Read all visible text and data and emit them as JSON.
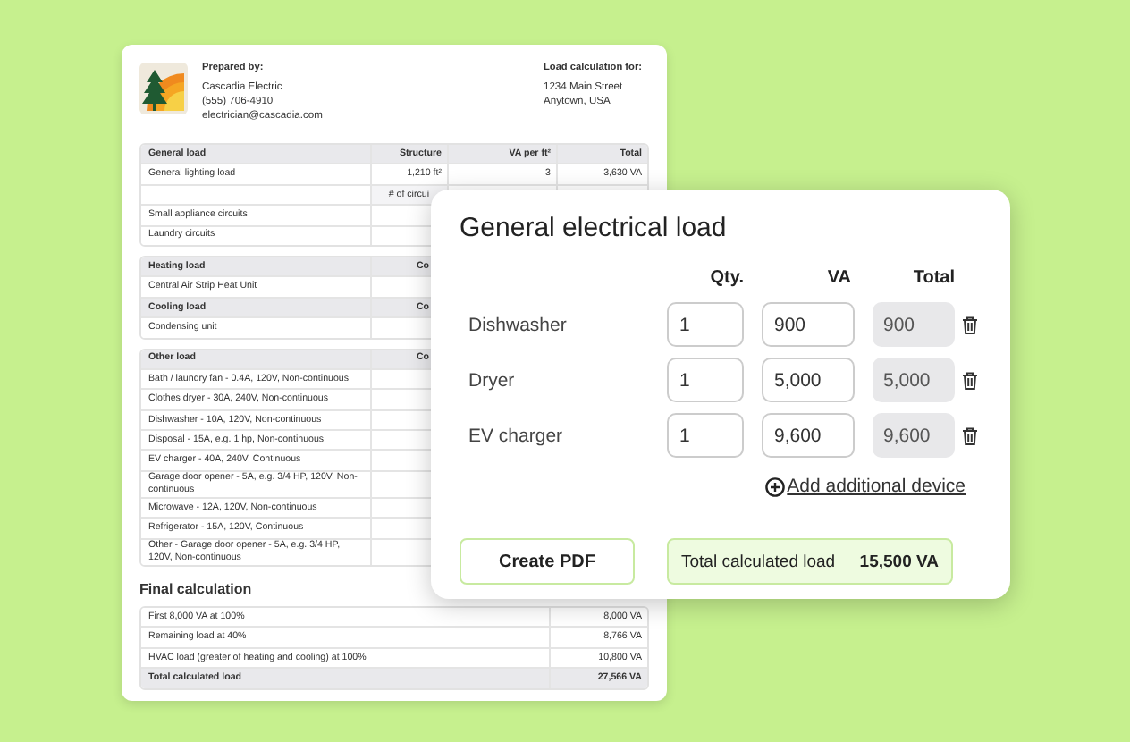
{
  "document": {
    "prepared_by": {
      "label": "Prepared by:",
      "lines": [
        "Cascadia Electric",
        "(555) 706-4910",
        "electrician@cascadia.com"
      ]
    },
    "load_for": {
      "label": "Load calculation for:",
      "lines": [
        "1234 Main Street",
        "Anytown, USA"
      ]
    },
    "tables": [
      {
        "kind": "full",
        "rows": [
          {
            "kind": "header",
            "label": "General load",
            "values": [
              "Structure",
              "VA per ft²",
              "Total"
            ]
          },
          {
            "kind": "row",
            "label": "General lighting load",
            "values": [
              "1,210 ft²",
              "3",
              "3,630 VA"
            ]
          },
          {
            "kind": "subheader",
            "values": [
              "# of circui"
            ]
          },
          {
            "kind": "row",
            "label": "Small appliance circuits"
          },
          {
            "kind": "row",
            "label": "Laundry circuits"
          }
        ]
      },
      {
        "kind": "partial",
        "rows": [
          {
            "kind": "header",
            "label": "Heating load",
            "values": [
              "Co"
            ]
          },
          {
            "kind": "row",
            "label": "Central Air Strip Heat Unit"
          },
          {
            "kind": "header",
            "label": "Cooling load",
            "values": [
              "Co"
            ]
          },
          {
            "kind": "row",
            "label": "Condensing unit"
          }
        ]
      },
      {
        "kind": "partial",
        "rows": [
          {
            "kind": "header",
            "label": "Other load",
            "values": [
              "Co"
            ]
          },
          {
            "kind": "row",
            "label": "Bath / laundry fan - 0.4A, 120V, Non-continuous"
          },
          {
            "kind": "row",
            "label": "Clothes dryer - 30A, 240V, Non-continuous"
          },
          {
            "kind": "row",
            "label": "Dishwasher - 10A, 120V, Non-continuous"
          },
          {
            "kind": "row",
            "label": "Disposal - 15A, e.g. 1 hp, Non-continuous"
          },
          {
            "kind": "row",
            "label": "EV charger - 40A, 240V, Continuous"
          },
          {
            "kind": "row",
            "label": "Garage door opener - 5A, e.g. 3/4 HP, 120V, Non-continuous"
          },
          {
            "kind": "row",
            "label": "Microwave - 12A, 120V, Non-continuous"
          },
          {
            "kind": "row",
            "label": "Refrigerator - 15A, 120V, Continuous"
          },
          {
            "kind": "row",
            "label": "Other - Garage door opener - 5A, e.g. 3/4 HP, 120V, Non-continuous"
          }
        ]
      }
    ],
    "final": {
      "title": "Final calculation",
      "rows": [
        {
          "kind": "row",
          "label": "First 8,000 VA at 100%",
          "value": "8,000 VA"
        },
        {
          "kind": "row",
          "label": "Remaining load at 40%",
          "value": "8,766 VA"
        },
        {
          "kind": "row",
          "label": "HVAC load (greater of heating and cooling) at 100%",
          "value": "10,800 VA"
        },
        {
          "kind": "total",
          "label": "Total calculated load",
          "value": "27,566 VA"
        }
      ]
    }
  },
  "dialog": {
    "title": "General electrical load",
    "columns": [
      "Qty.",
      "VA",
      "Total"
    ],
    "devices": [
      {
        "name": "Dishwasher",
        "qty": "1",
        "va": "900",
        "total": "900"
      },
      {
        "name": "Dryer",
        "qty": "1",
        "va": "5,000",
        "total": "5,000"
      },
      {
        "name": "EV charger",
        "qty": "1",
        "va": "9,600",
        "total": "9,600"
      }
    ],
    "add_link": "Add additional device",
    "create_button": "Create PDF",
    "total": {
      "label": "Total calculated load",
      "value": "15,500 VA"
    }
  }
}
